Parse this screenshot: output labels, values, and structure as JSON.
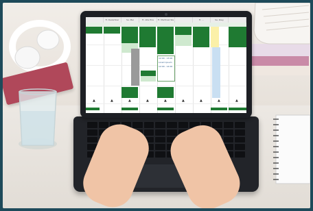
{
  "screen": {
    "day_headers": [
      "",
      "Fr. Dezember",
      "Sa. Mai",
      "Fr. Alte Erie",
      "Fr. Martinez Ste",
      "",
      "Fr. ...",
      "Sa. Rosy",
      ""
    ],
    "notes": [
      "12:00 - 13:00",
      "Lorem Ipsum",
      "12:00 - 14:00"
    ]
  },
  "colors": {
    "shift_green": "#1f7a32",
    "light_green": "#cfe9cf",
    "frame": "#1e4a5a"
  }
}
